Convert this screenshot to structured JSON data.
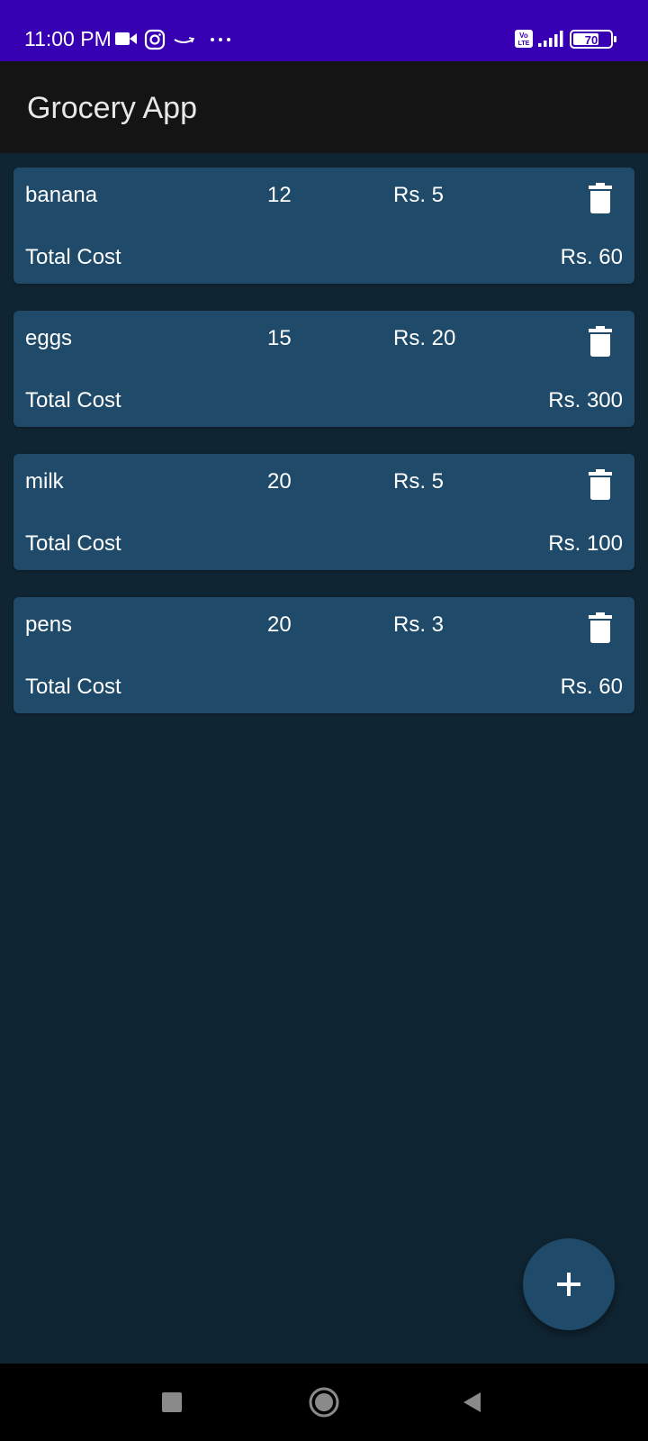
{
  "status_bar": {
    "time": "11:00 PM",
    "icons": [
      "video-camera-icon",
      "instagram-icon",
      "amazon-icon",
      "more-dots-icon",
      "volte-icon",
      "signal-icon",
      "battery-icon"
    ],
    "volte": "Vo LTE",
    "battery": "70",
    "color": "#3700b3"
  },
  "app_bar": {
    "title": "Grocery App"
  },
  "items": [
    {
      "name": "banana",
      "quantity": "12",
      "price": "Rs. 5",
      "total_label": "Total Cost",
      "total": "Rs. 60"
    },
    {
      "name": "eggs",
      "quantity": "15",
      "price": "Rs. 20",
      "total_label": "Total Cost",
      "total": "Rs. 300"
    },
    {
      "name": "milk",
      "quantity": "20",
      "price": "Rs. 5",
      "total_label": "Total Cost",
      "total": "Rs. 100"
    },
    {
      "name": "pens",
      "quantity": "20",
      "price": "Rs. 3",
      "total_label": "Total Cost",
      "total": "Rs. 60"
    }
  ],
  "fab": {
    "icon": "plus-icon"
  },
  "nav": {
    "icons": [
      "recents-square-icon",
      "home-circle-icon",
      "back-triangle-icon"
    ]
  },
  "colors": {
    "card": "#1f4a69",
    "background": "#102533",
    "app_bar": "#141414"
  }
}
